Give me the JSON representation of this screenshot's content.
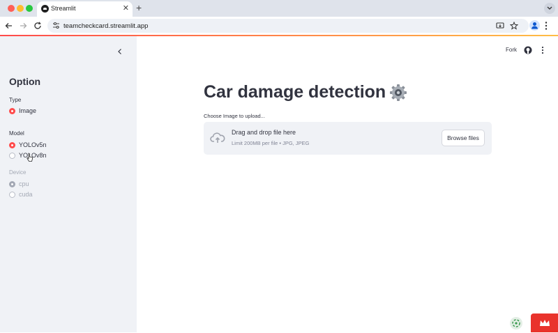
{
  "browser": {
    "tab_title": "Streamlit",
    "url": "teamcheckcard.streamlit.app"
  },
  "sidebar": {
    "title": "Option",
    "groups": [
      {
        "label": "Type",
        "options": [
          {
            "label": "Image",
            "selected": true
          }
        ]
      },
      {
        "label": "Model",
        "options": [
          {
            "label": "YOLOv5n",
            "selected": true
          },
          {
            "label": "YOLOv8n",
            "selected": false
          }
        ]
      },
      {
        "label": "Device",
        "disabled": true,
        "options": [
          {
            "label": "cpu",
            "selected": true
          },
          {
            "label": "cuda",
            "selected": false
          }
        ]
      }
    ]
  },
  "header": {
    "fork_label": "Fork"
  },
  "main": {
    "title": "Car damage detection",
    "upload": {
      "label": "Choose Image to upload...",
      "drop_text": "Drag and drop file here",
      "limit_text": "Limit 200MB per file • JPG, JPEG",
      "browse_label": "Browse files"
    }
  },
  "colors": {
    "accent": "#ff4b4b",
    "sidebar_bg": "#f0f2f6",
    "text": "#31333f"
  }
}
